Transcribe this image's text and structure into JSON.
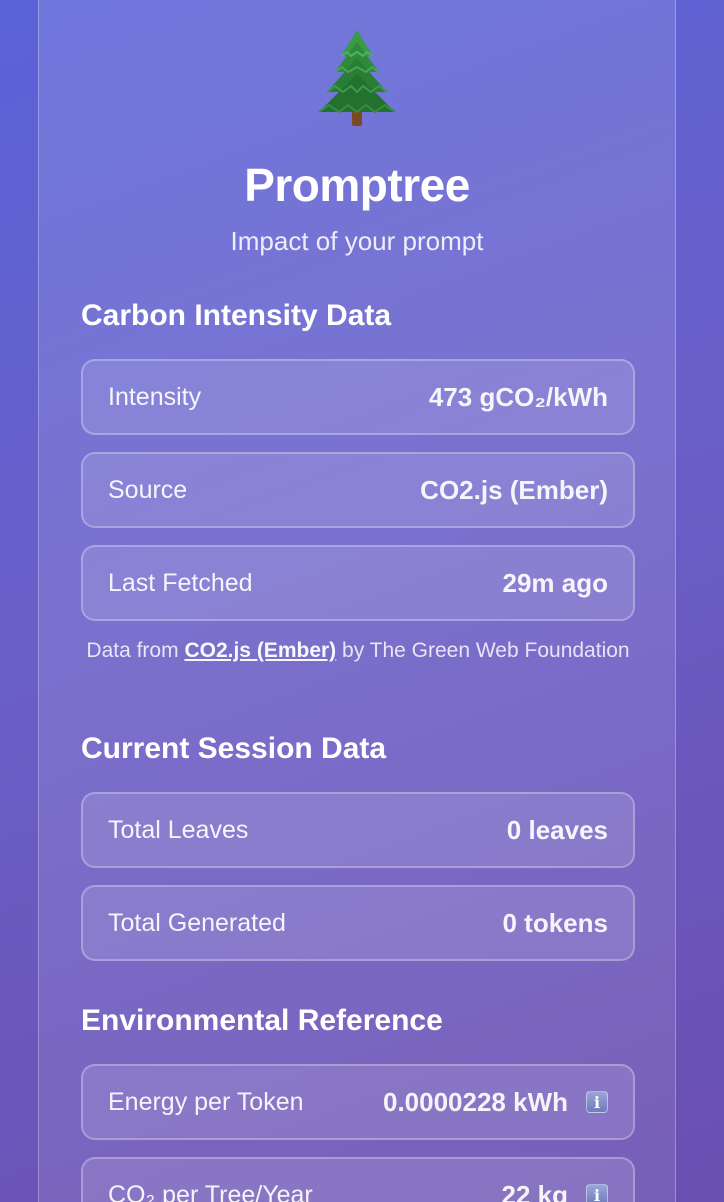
{
  "header": {
    "icon": "evergreen-tree-icon",
    "title": "Promptree",
    "subtitle": "Impact of your prompt"
  },
  "carbon_intensity": {
    "title": "Carbon Intensity Data",
    "rows": [
      {
        "label": "Intensity",
        "value": "473 gCO₂/kWh"
      },
      {
        "label": "Source",
        "value": "CO2.js (Ember)"
      },
      {
        "label": "Last Fetched",
        "value": "29m ago"
      }
    ],
    "attribution": {
      "prefix": "Data from",
      "link_text": "CO2.js (Ember)",
      "suffix": "by The Green Web Foundation"
    }
  },
  "session": {
    "title": "Current Session Data",
    "rows": [
      {
        "label": "Total Leaves",
        "value": "0 leaves"
      },
      {
        "label": "Total Generated",
        "value": "0 tokens"
      }
    ]
  },
  "environment": {
    "title": "Environmental Reference",
    "rows": [
      {
        "label": "Energy per Token",
        "value": "0.0000228 kWh",
        "icon": "info-icon"
      },
      {
        "label": "CO₂ per Tree/Year",
        "value": "22 kg",
        "icon": "info-icon"
      }
    ]
  },
  "colors": {
    "background_start": "#5a63d8",
    "background_end": "#6a4fb0",
    "tree_green": "#2f8a3c",
    "trunk_brown": "#7a4a22"
  }
}
